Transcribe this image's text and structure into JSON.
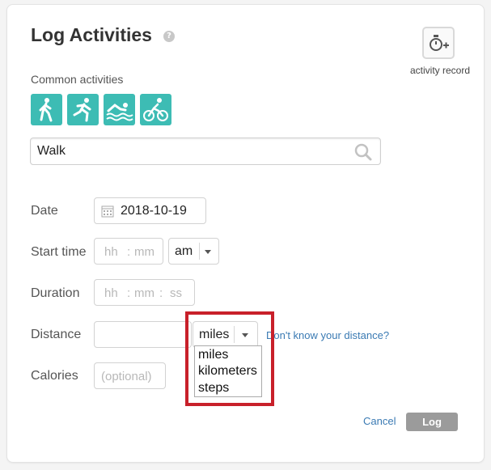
{
  "header": {
    "title": "Log Activities",
    "help_icon": "?"
  },
  "activity_record": {
    "label": "activity record",
    "icon": "stopwatch-plus-icon"
  },
  "common": {
    "label": "Common activities",
    "items": [
      {
        "name": "walk",
        "icon": "walk-icon"
      },
      {
        "name": "run",
        "icon": "run-icon"
      },
      {
        "name": "swim",
        "icon": "swim-icon"
      },
      {
        "name": "bike",
        "icon": "bike-icon"
      }
    ],
    "accent": "#3dbcb4"
  },
  "search": {
    "value": "Walk"
  },
  "date": {
    "label": "Date",
    "value": "2018-10-19"
  },
  "start_time": {
    "label": "Start time",
    "hh": "hh",
    "mm": "mm",
    "sep": ":",
    "ampm": "am"
  },
  "duration": {
    "label": "Duration",
    "hh": "hh",
    "mm": "mm",
    "ss": "ss",
    "sep": ":"
  },
  "distance": {
    "label": "Distance",
    "unit": "miles",
    "options": [
      "miles",
      "kilometers",
      "steps"
    ],
    "help_link": "Don't know your distance?"
  },
  "calories": {
    "label": "Calories",
    "placeholder": "(optional)"
  },
  "actions": {
    "cancel": "Cancel",
    "log": "Log"
  },
  "colors": {
    "highlight": "#c8202a",
    "link": "#3a7ab3",
    "log_button": "#9b9b9b"
  }
}
